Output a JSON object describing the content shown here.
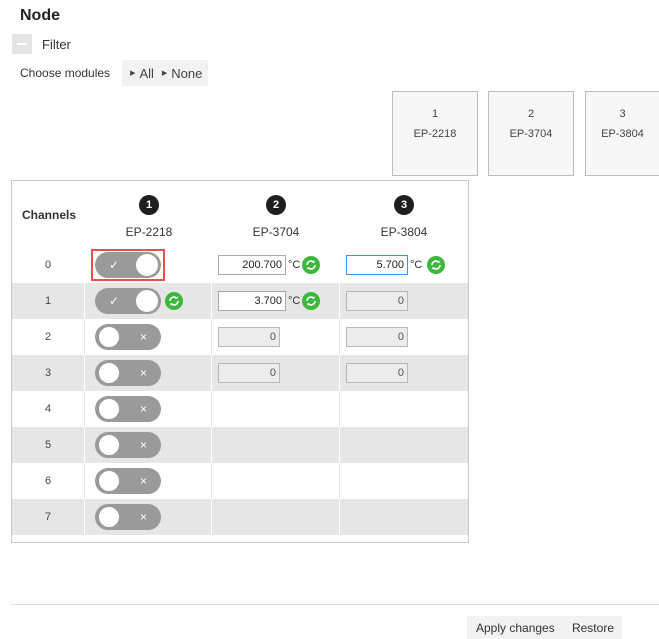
{
  "title": "Node",
  "filter": {
    "label": "Filter"
  },
  "choose": {
    "label": "Choose modules",
    "all": "All",
    "none": "None"
  },
  "modules": [
    {
      "num": "1",
      "name": "EP-2218"
    },
    {
      "num": "2",
      "name": "EP-3704"
    },
    {
      "num": "3",
      "name": "EP-3804"
    }
  ],
  "grid": {
    "channels_header": "Channels",
    "columns": [
      {
        "badge": "1",
        "name": "EP-2218"
      },
      {
        "badge": "2",
        "name": "EP-3704"
      },
      {
        "badge": "3",
        "name": "EP-3804"
      }
    ],
    "rows": [
      {
        "ch": "0",
        "toggle": "on",
        "toggle_mark": "✓",
        "ep3704": {
          "value": "200.700",
          "unit": "°C"
        },
        "ep3804": {
          "value": "5.700",
          "unit": "°C"
        }
      },
      {
        "ch": "1",
        "toggle": "on",
        "toggle_mark": "✓",
        "ep3704": {
          "value": "3.700",
          "unit": "°C"
        },
        "ep3804": {
          "value": "0"
        }
      },
      {
        "ch": "2",
        "toggle": "off",
        "toggle_mark": "×",
        "ep3704": {
          "value": "0"
        },
        "ep3804": {
          "value": "0"
        }
      },
      {
        "ch": "3",
        "toggle": "off",
        "toggle_mark": "×",
        "ep3704": {
          "value": "0"
        },
        "ep3804": {
          "value": "0"
        }
      },
      {
        "ch": "4",
        "toggle": "off",
        "toggle_mark": "×"
      },
      {
        "ch": "5",
        "toggle": "off",
        "toggle_mark": "×"
      },
      {
        "ch": "6",
        "toggle": "off",
        "toggle_mark": "×"
      },
      {
        "ch": "7",
        "toggle": "off",
        "toggle_mark": "×"
      }
    ]
  },
  "footer": {
    "apply": "Apply changes",
    "restore": "Restore"
  },
  "colors": {
    "refresh": "#3cb83c",
    "focus": "#e25050",
    "toggle": "#9a9a9a",
    "active_input": "#4a90e2"
  }
}
